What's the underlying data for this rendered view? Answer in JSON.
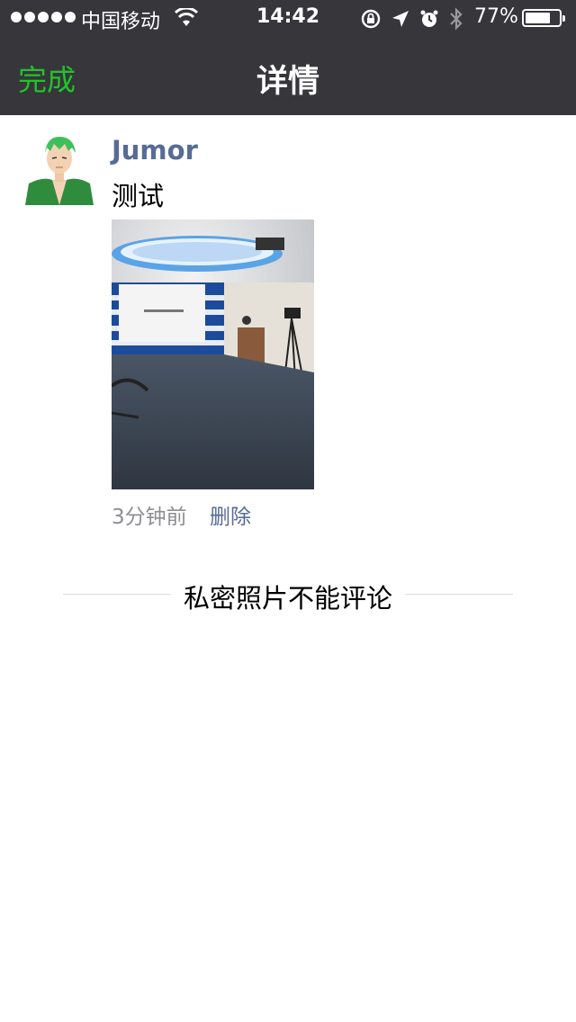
{
  "status_bar": {
    "carrier": "中国移动",
    "time": "14:42",
    "battery": "77%",
    "battery_level": 0.77,
    "icons": [
      "signal-dots-icon",
      "wifi-icon",
      "orientation-lock-icon",
      "location-arrow-icon",
      "alarm-icon",
      "bluetooth-icon",
      "battery-icon"
    ]
  },
  "nav": {
    "done_label": "完成",
    "title": "详情"
  },
  "post": {
    "username": "Jumor",
    "text": "测试",
    "time_ago": "3分钟前",
    "delete_label": "删除"
  },
  "comments_notice": "私密照片不能评论",
  "colors": {
    "nav_background": "#37363b",
    "done_green": "#20c429",
    "link_blue": "#576b95",
    "meta_gray": "#8e8e93"
  }
}
